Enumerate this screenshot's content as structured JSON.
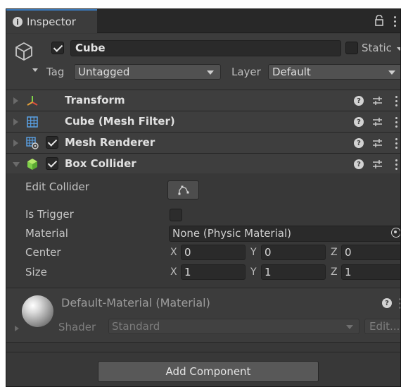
{
  "window": {
    "tab_title": "Inspector",
    "icons": [
      "info-icon",
      "lock-icon",
      "kebab-menu-icon"
    ]
  },
  "gameobject": {
    "active": true,
    "name": "Cube",
    "static_label": "Static",
    "static": false,
    "tag_label": "Tag",
    "tag_value": "Untagged",
    "layer_label": "Layer",
    "layer_value": "Default"
  },
  "components": [
    {
      "title": "Transform",
      "icon": "transform-axes-icon",
      "expanded": false,
      "has_toggle": false
    },
    {
      "title": "Cube (Mesh Filter)",
      "icon": "mesh-filter-grid-icon",
      "expanded": false,
      "has_toggle": false
    },
    {
      "title": "Mesh Renderer",
      "icon": "mesh-renderer-icon",
      "expanded": false,
      "has_toggle": true,
      "enabled": true
    },
    {
      "title": "Box Collider",
      "icon": "box-collider-cube-icon",
      "expanded": true,
      "has_toggle": true,
      "enabled": true
    }
  ],
  "box_collider": {
    "edit_collider_label": "Edit Collider",
    "is_trigger_label": "Is Trigger",
    "is_trigger": false,
    "material_label": "Material",
    "material_value": "None (Physic Material)",
    "center_label": "Center",
    "center": {
      "x": "0",
      "y": "0",
      "z": "0"
    },
    "size_label": "Size",
    "size": {
      "x": "1",
      "y": "1",
      "z": "1"
    },
    "axis_labels": {
      "x": "X",
      "y": "Y",
      "z": "Z"
    }
  },
  "material": {
    "title": "Default-Material (Material)",
    "shader_label": "Shader",
    "shader_value": "Standard",
    "edit_label": "Edit..."
  },
  "add_component_label": "Add Component",
  "colors": {
    "panel": "#383838",
    "header": "#3c3c3c",
    "tab_accent": "#3a79bb",
    "field": "#2a2a2a"
  }
}
